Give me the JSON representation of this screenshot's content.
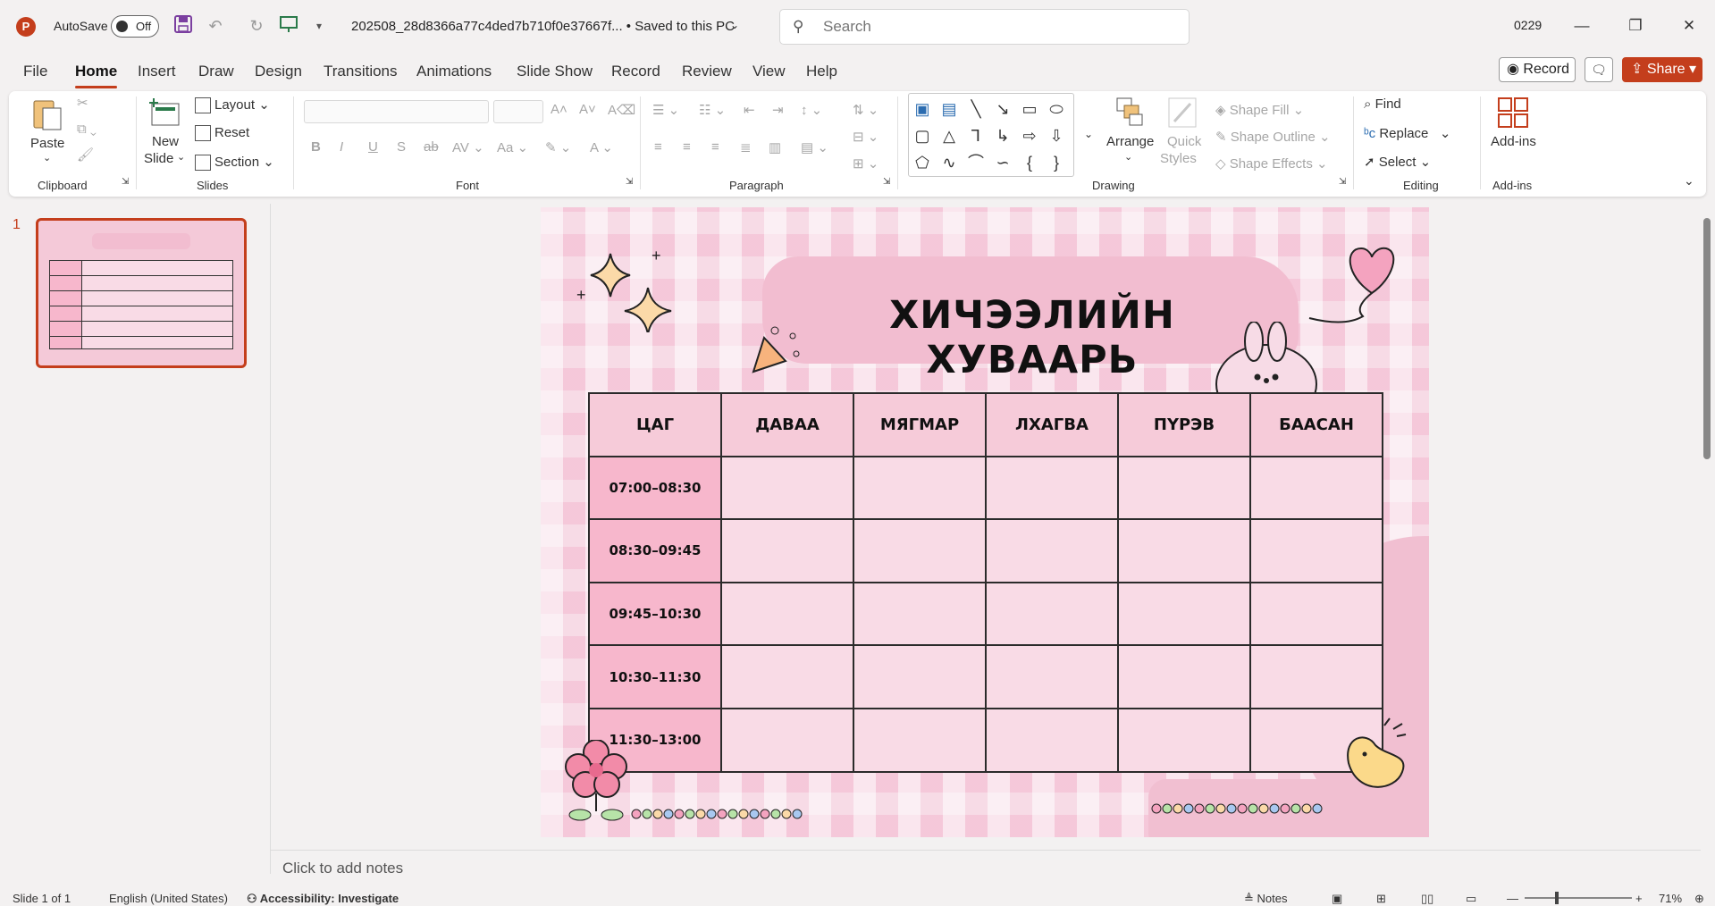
{
  "app": {
    "autosave_label": "AutoSave",
    "autosave_state": "Off",
    "document_title": "202508_28d8366a77c4ded7b710f0e37667f...  •  Saved to this PC",
    "search_placeholder": "Search",
    "user": "0229",
    "accent": "#c43e1c"
  },
  "menu": {
    "tabs": [
      "File",
      "Home",
      "Insert",
      "Draw",
      "Design",
      "Transitions",
      "Animations",
      "Slide Show",
      "Record",
      "Review",
      "View",
      "Help"
    ],
    "record": "Record",
    "share": "Share"
  },
  "ribbon": {
    "clipboard": {
      "paste": "Paste",
      "label": "Clipboard"
    },
    "slides": {
      "new_slide_1": "New",
      "new_slide_2": "Slide",
      "layout": "Layout",
      "reset": "Reset",
      "section": "Section",
      "label": "Slides"
    },
    "font": {
      "label": "Font"
    },
    "paragraph": {
      "label": "Paragraph"
    },
    "drawing": {
      "arrange": "Arrange",
      "quick_styles_1": "Quick",
      "quick_styles_2": "Styles",
      "shape_fill": "Shape Fill",
      "shape_outline": "Shape Outline",
      "shape_effects": "Shape Effects",
      "label": "Drawing"
    },
    "editing": {
      "find": "Find",
      "replace": "Replace",
      "select": "Select",
      "label": "Editing"
    },
    "addins": {
      "button": "Add-ins",
      "label": "Add-ins"
    }
  },
  "thumbnails": [
    {
      "number": "1"
    }
  ],
  "slide": {
    "title": "ХИЧЭЭЛИЙН ХУВААРЬ",
    "headers": [
      "ЦАГ",
      "ДАВАА",
      "МЯГМАР",
      "ЛХАГВА",
      "ПҮРЭВ",
      "БААСАН"
    ],
    "times": [
      "07:00–08:30",
      "08:30–09:45",
      "09:45–10:30",
      "10:30–11:30",
      "11:30–13:00"
    ]
  },
  "notes_placeholder": "Click to add notes",
  "status": {
    "slide": "Slide 1 of 1",
    "language": "English (United States)",
    "accessibility": "Accessibility: Investigate",
    "notes": "Notes",
    "zoom": "71%"
  }
}
